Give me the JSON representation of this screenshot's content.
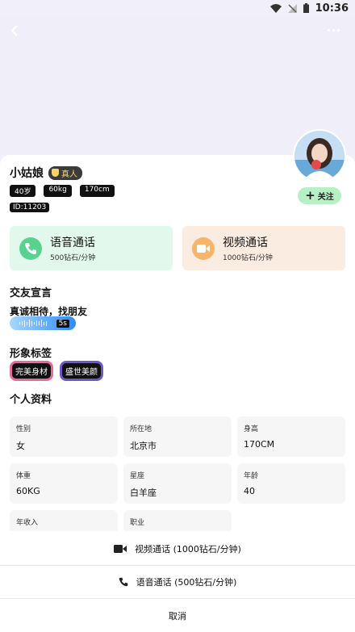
{
  "status_bar": {
    "time": "10:36"
  },
  "profile": {
    "name": "小姑娘",
    "verified_badge": "真人",
    "age": "40岁",
    "weight_chip": "60kg",
    "height_chip": "170cm",
    "id_label": "ID:11203",
    "follow_label": "关注"
  },
  "calls": {
    "voice": {
      "title": "语音通话",
      "price": "500钻石/分钟"
    },
    "video": {
      "title": "视频通话",
      "price": "1000钻石/分钟"
    }
  },
  "sections": {
    "motto_title": "交友宣言",
    "motto_text": "真诚相待，找朋友",
    "voice_duration": "5s",
    "tags_title": "形象标签",
    "tags": [
      "完美身材",
      "盛世美颜"
    ],
    "profile_title": "个人资料"
  },
  "details": [
    {
      "label": "性别",
      "value": "女"
    },
    {
      "label": "所在地",
      "value": "北京市"
    },
    {
      "label": "身高",
      "value": "170CM"
    },
    {
      "label": "体重",
      "value": "60KG"
    },
    {
      "label": "星座",
      "value": "白羊座"
    },
    {
      "label": "年龄",
      "value": "40"
    },
    {
      "label": "年收入",
      "value": ""
    },
    {
      "label": "职业",
      "value": ""
    }
  ],
  "action_sheet": {
    "video_call": "视频通话 (1000钻石/分钟)",
    "voice_call": "语音通话 (500钻石/分钟)",
    "cancel": "取消"
  },
  "colors": {
    "voice_card_bg": "#e3f8ec",
    "video_card_bg": "#fbece1",
    "follow_bg": "#b8f0c6"
  }
}
